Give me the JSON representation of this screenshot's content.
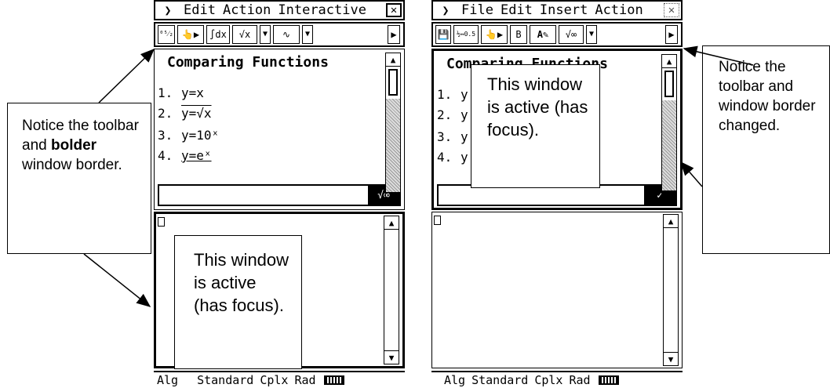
{
  "left_screen": {
    "menu": [
      "Edit",
      "Action",
      "Interactive"
    ],
    "menu_icon": "chevron-down-icon",
    "close_icon": "close-icon",
    "toolbar": [
      "⁰⁵⁄₂",
      "👆▶",
      "∫dx",
      "√x",
      "▼",
      "∿",
      "▼",
      "▶"
    ],
    "doc_title": "Comparing Functions",
    "functions": [
      {
        "num": "1.",
        "text": "y=x"
      },
      {
        "num": "2.",
        "text": "y=√x"
      },
      {
        "num": "3.",
        "text": "y=10ˣ"
      },
      {
        "num": "4.",
        "text": "y=eˣ"
      }
    ],
    "entry_tool": "√∞",
    "status": {
      "mode": "Alg",
      "format": "Standard",
      "complex": "Cplx",
      "angle": "Rad"
    }
  },
  "right_screen": {
    "menu": [
      "File",
      "Edit",
      "Insert",
      "Action"
    ],
    "menu_icon": "chevron-down-icon",
    "close_icon": "close-icon",
    "toolbar": [
      "💾",
      "½↔0.5",
      "👆▶",
      "B",
      "A✎",
      "√∞",
      "▼",
      "▶"
    ],
    "doc_title": "Comparing Functions",
    "function_nums": [
      "1.",
      "2.",
      "3.",
      "4."
    ],
    "function_stubs": [
      "y",
      "y",
      "y",
      "y"
    ],
    "status": {
      "mode": "Alg",
      "format": "Standard",
      "complex": "Cplx",
      "angle": "Rad"
    }
  },
  "callouts": {
    "left_prefix": "Notice the toolbar and",
    "left_bold": "bolder",
    "left_suffix": "window border.",
    "left_active": "This window is active (has focus).",
    "right_active": "This window is active (has focus).",
    "right_notice": "Notice the toolbar and window border changed."
  }
}
